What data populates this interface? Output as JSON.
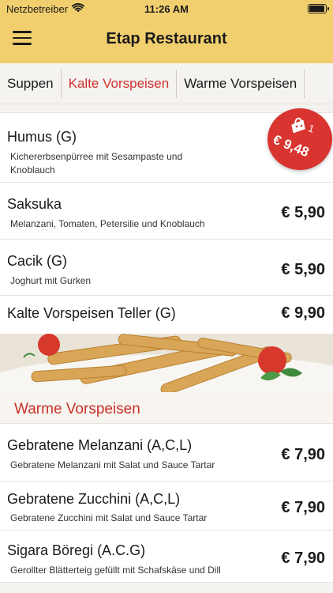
{
  "status": {
    "carrier": "Netzbetreiber",
    "time": "11:26 AM"
  },
  "nav": {
    "title": "Etap Restaurant"
  },
  "tabs": [
    {
      "label": "Suppen"
    },
    {
      "label": "Kalte Vorspeisen"
    },
    {
      "label": "Warme Vorspeisen"
    }
  ],
  "cold_items": [
    {
      "name": "Humus (G)",
      "desc": "Kichererbsenpürree mit Sesampaste und Knoblauch",
      "price": ""
    },
    {
      "name": "Saksuka",
      "desc": "Melanzani, Tomaten, Petersilie und Knoblauch",
      "price": "€ 5,90"
    },
    {
      "name": "Cacik (G)",
      "desc": "Joghurt mit Gurken",
      "price": "€ 5,90"
    },
    {
      "name": "Kalte Vorspeisen Teller (G)",
      "desc": "",
      "price": "€ 9,90"
    }
  ],
  "section": {
    "title": "Warme Vorspeisen"
  },
  "warm_items": [
    {
      "name": "Gebratene Melanzani (A,C,L)",
      "desc": "Gebratene Melanzani mit Salat und Sauce Tartar",
      "price": "€ 7,90"
    },
    {
      "name": "Gebratene Zucchini (A,C,L)",
      "desc": "Gebratene Zucchini mit Salat und Sauce Tartar",
      "price": "€ 7,90"
    },
    {
      "name": "Sigara Böregi (A.C.G)",
      "desc": "Gerollter Blätterteig gefüllt mit Schafskäse und Dill",
      "price": "€ 7,90"
    }
  ],
  "cart": {
    "count": "1",
    "total": "€ 9,48"
  },
  "colors": {
    "header": "#f2cf6e",
    "accent": "#d0312d",
    "cart": "#d9342f"
  },
  "icons": {
    "menu": "hamburger-menu-icon",
    "wifi": "wifi-icon",
    "battery": "battery-icon",
    "cart": "shopping-bag-icon"
  }
}
